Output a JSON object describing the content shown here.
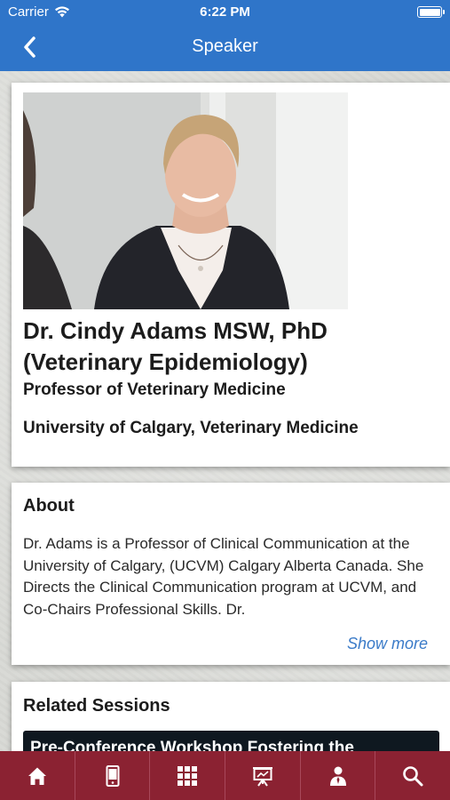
{
  "status_bar": {
    "carrier": "Carrier",
    "time": "6:22 PM"
  },
  "nav": {
    "title": "Speaker",
    "back_icon": "chevron-left-icon"
  },
  "speaker": {
    "name": "Dr. Cindy Adams MSW, PhD (Veterinary Epidemiology)",
    "title": "Professor of Veterinary Medicine",
    "organization": "University of Calgary, Veterinary Medicine"
  },
  "about": {
    "heading": "About",
    "text": "Dr. Adams is a Professor of Clinical Communication at the University of Calgary, (UCVM) Calgary Alberta Canada. She Directs the Clinical Communication program at UCVM, and Co-Chairs Professional Skills. Dr.",
    "show_more_label": "Show more"
  },
  "related_sessions": {
    "heading": "Related Sessions",
    "items": [
      {
        "title": "Pre-Conference Workshop Fostering the"
      }
    ]
  },
  "tab_bar": {
    "tabs": [
      {
        "icon": "home-icon"
      },
      {
        "icon": "mobile-device-icon"
      },
      {
        "icon": "grid-icon"
      },
      {
        "icon": "presentation-board-icon"
      },
      {
        "icon": "speaker-person-icon"
      },
      {
        "icon": "search-icon"
      }
    ]
  },
  "colors": {
    "header_blue": "#2f75c9",
    "tab_bar_maroon": "#8b2232",
    "link_blue": "#3b7bc8"
  }
}
